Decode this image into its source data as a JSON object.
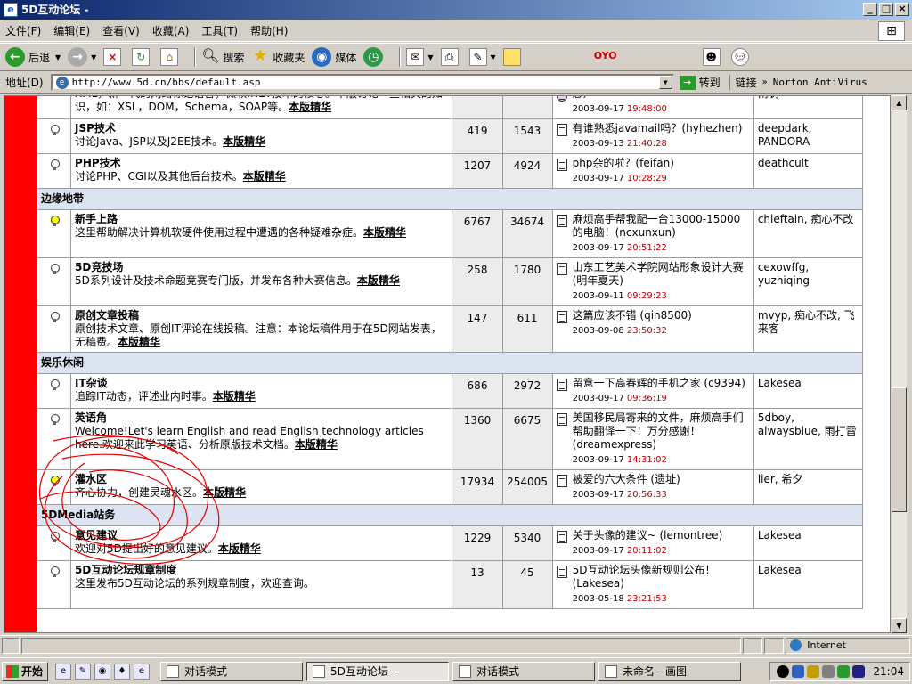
{
  "window": {
    "title": "5D互动论坛 -",
    "app_icon": "ie-icon"
  },
  "menu": [
    "文件(F)",
    "编辑(E)",
    "查看(V)",
    "收藏(A)",
    "工具(T)",
    "帮助(H)"
  ],
  "toolbar": {
    "back": "后退",
    "search": "搜索",
    "favorites": "收藏夹",
    "media": "媒体"
  },
  "address": {
    "label": "地址(D)",
    "url": "http://www.5d.cn/bbs/default.asp",
    "go": "转到",
    "links": "链接",
    "norton": "Norton AntiVirus"
  },
  "forum": {
    "top_row": {
      "desc": "XML，新一代的网络标记语言，微软.NET技术的核心。本版讨论一些相关的知识，如：XSL，DOM，Schema，SOAP等。",
      "elite": "本版精华",
      "last_title": "急）",
      "last_date": "2003-09-17",
      "last_time": "19:48:00",
      "mods": "南钊"
    },
    "sections": [
      {
        "category": "",
        "rows": [
          {
            "name": "JSP技术",
            "desc": "讨论Java、JSP以及J2EE技术。",
            "elite": "本版精华",
            "topics": "419",
            "posts": "1543",
            "last_title": "有谁熟悉javamail吗？(hyhezhen)",
            "last_date": "2003-09-13",
            "last_time": "21:40:28",
            "mods": "deepdark, PANDORA",
            "lit": false
          },
          {
            "name": "PHP技术",
            "desc": "讨论PHP、CGI以及其他后台技术。",
            "elite": "本版精华",
            "topics": "1207",
            "posts": "4924",
            "last_title": "php杂的啦？(feifan)",
            "last_date": "2003-09-17",
            "last_time": "10:28:29",
            "mods": "deathcult",
            "lit": false
          }
        ]
      },
      {
        "category": "边缘地带",
        "rows": [
          {
            "name": "新手上路",
            "desc": "这里帮助解决计算机软硬件使用过程中遭遇的各种疑难杂症。",
            "elite": "本版精华",
            "topics": "6767",
            "posts": "34674",
            "last_title": "麻烦高手帮我配一台13000-15000的电脑！(ncxunxun)",
            "last_date": "2003-09-17",
            "last_time": "20:51:22",
            "mods": "chieftain, 痴心不改",
            "lit": true
          },
          {
            "name": "5D竞技场",
            "desc": "5D系列设计及技术命题竞赛专门版，并发布各种大赛信息。",
            "elite": "本版精华",
            "topics": "258",
            "posts": "1780",
            "last_title": "山东工艺美术学院网站形象设计大赛(明年夏天)",
            "last_date": "2003-09-11",
            "last_time": "09:29:23",
            "mods": "cexowffg, yuzhiqing",
            "lit": false
          },
          {
            "name": "原创文章投稿",
            "desc": "原创技术文章、原创IT评论在线投稿。注意：本论坛稿件用于在5D网站发表，无稿费。",
            "elite": "本版精华",
            "topics": "147",
            "posts": "611",
            "last_title": "这篇应该不错 (qin8500)",
            "last_date": "2003-09-08",
            "last_time": "23:50:32",
            "mods": "mvyp, 痴心不改, 飞来客",
            "lit": false
          }
        ]
      },
      {
        "category": "娱乐休闲",
        "rows": [
          {
            "name": "IT杂谈",
            "desc": "追踪IT动态，评述业内时事。",
            "elite": "本版精华",
            "topics": "686",
            "posts": "2972",
            "last_title": "留意一下高春辉的手机之家 (c9394)",
            "last_date": "2003-09-17",
            "last_time": "09:36:19",
            "mods": "Lakesea",
            "lit": false
          },
          {
            "name": "英语角",
            "desc": "Welcome!Let's learn English and read English technology articles here.欢迎来此学习英语、分析原版技术文档。",
            "elite": "本版精华",
            "topics": "1360",
            "posts": "6675",
            "last_title": "美国移民局寄来的文件，麻烦高手们帮助翻译一下！万分感谢！(dreamexpress)",
            "last_date": "2003-09-17",
            "last_time": "14:31:02",
            "mods": "5dboy, alwaysblue, 雨打雷",
            "lit": false
          },
          {
            "name": "灌水区",
            "desc": "齐心协力，创建灵魂水区。",
            "elite": "本版精华",
            "topics": "17934",
            "posts": "254005",
            "last_title": "被爱的六大条件 (遗址)",
            "last_date": "2003-09-17",
            "last_time": "20:56:33",
            "mods": "lier, 希夕",
            "lit": true
          }
        ]
      },
      {
        "category": "5DMedia站务",
        "rows": [
          {
            "name": "意见建议",
            "desc": "欢迎对5D提出好的意见建议。",
            "elite": "本版精华",
            "topics": "1229",
            "posts": "5340",
            "last_title": "关于头像的建议~ (lemontree)",
            "last_date": "2003-09-17",
            "last_time": "20:11:02",
            "mods": "Lakesea",
            "lit": false
          },
          {
            "name": "5D互动论坛规章制度",
            "desc": "这里发布5D互动论坛的系列规章制度，欢迎查询。",
            "elite": "",
            "topics": "13",
            "posts": "45",
            "last_title": "5D互动论坛头像新规则公布！(Lakesea)",
            "last_date": "2003-05-18",
            "last_time": "23:21:53",
            "mods": "Lakesea",
            "lit": false
          }
        ]
      }
    ]
  },
  "status": {
    "zone": "Internet"
  },
  "taskbar": {
    "start": "开始",
    "tasks": [
      "对话模式",
      "5D互动论坛 -",
      "对话模式",
      "未命名 - 画图"
    ],
    "clock": "21:04"
  },
  "colors": {
    "sidebar_red": "#ff0000",
    "category_bg": "#dbe4f0",
    "scribble": "#e00000"
  }
}
